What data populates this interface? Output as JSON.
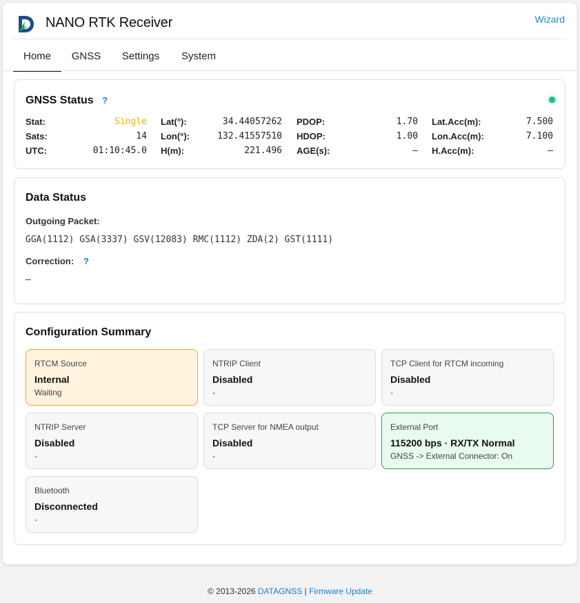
{
  "header": {
    "title": "NANO RTK Receiver",
    "wizard_label": "Wizard",
    "logo_icon": "datagnss-logo-icon"
  },
  "tabs": [
    {
      "label": "Home",
      "active": true
    },
    {
      "label": "GNSS",
      "active": false
    },
    {
      "label": "Settings",
      "active": false
    },
    {
      "label": "System",
      "active": false
    }
  ],
  "gnss_status": {
    "title": "GNSS Status",
    "help": "?",
    "indicator_color": "#19c27a",
    "stat_label": "Stat:",
    "stat_value": "Single",
    "sats_label": "Sats:",
    "sats_value": "14",
    "utc_label": "UTC:",
    "utc_value": "01:10:45.0",
    "lat_label": "Lat(°):",
    "lat_value": "34.44057262",
    "lon_label": "Lon(°):",
    "lon_value": "132.41557510",
    "h_label": "H(m):",
    "h_value": "221.496",
    "pdop_label": "PDOP:",
    "pdop_value": "1.70",
    "hdop_label": "HDOP:",
    "hdop_value": "1.00",
    "age_label": "AGE(s):",
    "age_value": "–",
    "latacc_label": "Lat.Acc(m):",
    "latacc_value": "7.500",
    "lonacc_label": "Lon.Acc(m):",
    "lonacc_value": "7.100",
    "hacc_label": "H.Acc(m):",
    "hacc_value": "–"
  },
  "data_status": {
    "title": "Data Status",
    "outgoing_label": "Outgoing Packet:",
    "outgoing_value": "GGA(1112) GSA(3337) GSV(12083) RMC(1112) ZDA(2) GST(1111)",
    "correction_label": "Correction:",
    "correction_help": "?",
    "correction_value": "–"
  },
  "config_summary": {
    "title": "Configuration Summary",
    "tiles": [
      {
        "label": "RTCM Source",
        "value": "Internal",
        "sub": "Waiting",
        "state": "warn"
      },
      {
        "label": "NTRIP Client",
        "value": "Disabled",
        "sub": "-",
        "state": "neutral"
      },
      {
        "label": "TCP Client for RTCM incoming",
        "value": "Disabled",
        "sub": "-",
        "state": "neutral"
      },
      {
        "label": "NTRIP Server",
        "value": "Disabled",
        "sub": "-",
        "state": "neutral"
      },
      {
        "label": "TCP Server for NMEA output",
        "value": "Disabled",
        "sub": "-",
        "state": "neutral"
      },
      {
        "label": "External Port",
        "value": "115200 bps · RX/TX Normal",
        "sub": "GNSS -> External Connector: On",
        "state": "ok"
      },
      {
        "label": "Bluetooth",
        "value": "Disconnected",
        "sub": "-",
        "state": "neutral"
      }
    ]
  },
  "footer": {
    "copyright": "© 2013-2026",
    "brand_link": "DATAGNSS",
    "separator": "|",
    "firmware_link": "Firmware Update"
  }
}
